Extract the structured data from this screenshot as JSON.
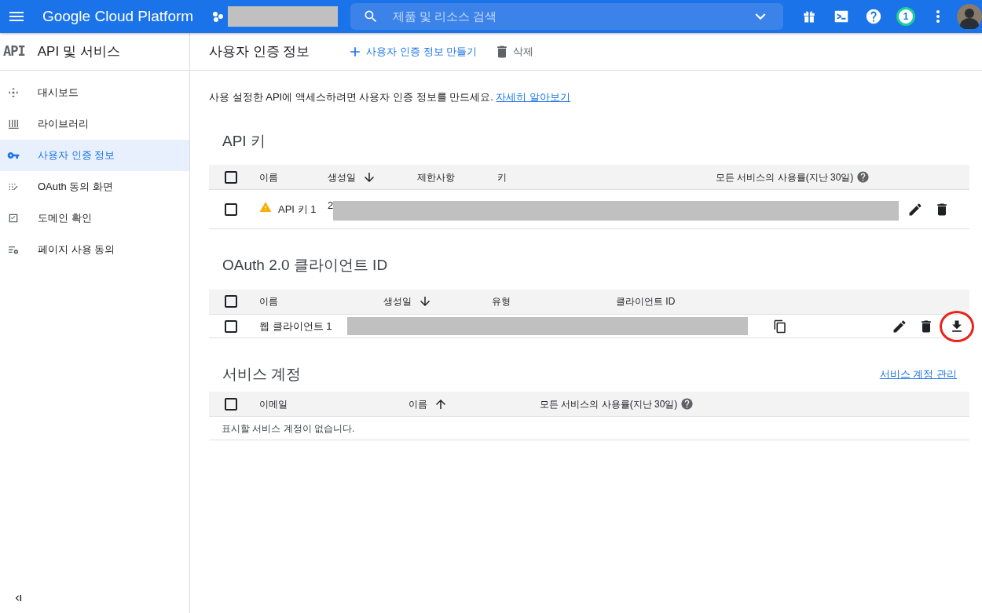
{
  "topbar": {
    "title": "Google Cloud Platform",
    "search": {
      "placeholder": "제품 및 리소스 검색"
    },
    "notification_count": "1"
  },
  "sidebar": {
    "logo": "API",
    "title": "API 및 서비스",
    "items": [
      {
        "label": "대시보드",
        "kind": "dashboard",
        "selected": false
      },
      {
        "label": "라이브러리",
        "kind": "library",
        "selected": false
      },
      {
        "label": "사용자 인증 정보",
        "kind": "key",
        "selected": true
      },
      {
        "label": "OAuth 동의 화면",
        "kind": "consent",
        "selected": false
      },
      {
        "label": "도메인 확인",
        "kind": "domain",
        "selected": false
      },
      {
        "label": "페이지 사용 동의",
        "kind": "settings",
        "selected": false
      }
    ]
  },
  "page": {
    "title": "사용자 인증 정보",
    "actions": [
      {
        "label": "사용자 인증 정보 만들기",
        "kind": "create",
        "disabled": false
      },
      {
        "label": "삭제",
        "kind": "delete",
        "disabled": true
      }
    ],
    "intro": "사용 설정한 API에 액세스하려면 사용자 인증 정보를 만드세요.",
    "intro_link": "자세히 알아보기"
  },
  "api_keys": {
    "title": "API 키",
    "header_checked": false,
    "columns": [
      {
        "label": "이름"
      },
      {
        "label": "생성일",
        "sorted": true,
        "descending": true
      },
      {
        "label": "제한사항"
      },
      {
        "label": "키"
      },
      {
        "label": "모든 서비스의 사용률(지난 30일)",
        "help": true
      }
    ],
    "rows": [
      {
        "checked": false,
        "warning": true,
        "name": "API 키 1",
        "created": "2",
        "actions": [
          {
            "kind": "edit"
          },
          {
            "kind": "delete"
          }
        ]
      }
    ]
  },
  "oauth": {
    "title": "OAuth 2.0 클라이언트 ID",
    "header_checked": false,
    "columns": [
      {
        "label": "이름"
      },
      {
        "label": "생성일",
        "sorted": true,
        "descending": true
      },
      {
        "label": "유형"
      },
      {
        "label": "클라이언트 ID"
      }
    ],
    "rows": [
      {
        "checked": false,
        "name": "웹 클라이언트 1",
        "actions": [
          {
            "kind": "edit"
          },
          {
            "kind": "delete"
          },
          {
            "kind": "download",
            "highlighted": true
          }
        ]
      }
    ]
  },
  "service_accounts": {
    "title": "서비스 계정",
    "manage_link": "서비스 계정 관리",
    "header_checked": false,
    "columns": [
      {
        "label": "이메일"
      },
      {
        "label": "이름",
        "sorted": true,
        "descending": false
      },
      {
        "label": "모든 서비스의 사용률(지난 30일)",
        "help": true
      }
    ],
    "empty": "표시할 서비스 계정이 없습니다."
  }
}
